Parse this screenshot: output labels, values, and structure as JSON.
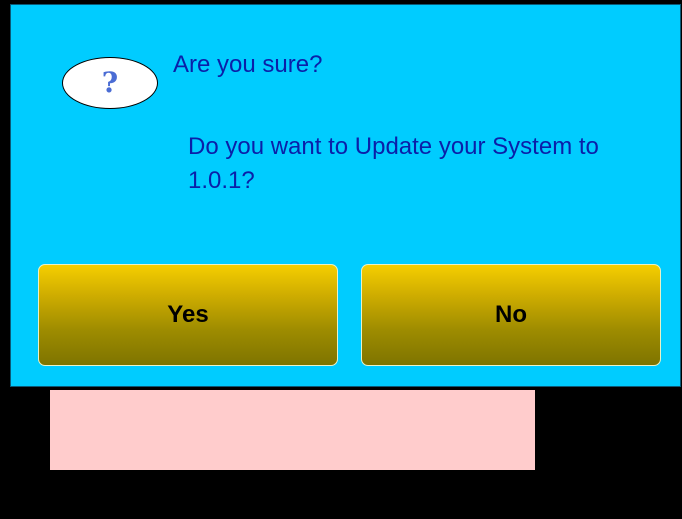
{
  "dialog": {
    "icon": "question-icon",
    "icon_glyph": "?",
    "title": "Are you sure?",
    "message": "Do you want to Update your System to 1.0.1?",
    "yes_label": "Yes",
    "no_label": "No"
  },
  "colors": {
    "dialog_background": "#00ccff",
    "text": "#0b1fa8",
    "button_top": "#f5ce00",
    "button_bottom": "#7e7400",
    "panel": "#ffcccc",
    "background": "#000000"
  }
}
